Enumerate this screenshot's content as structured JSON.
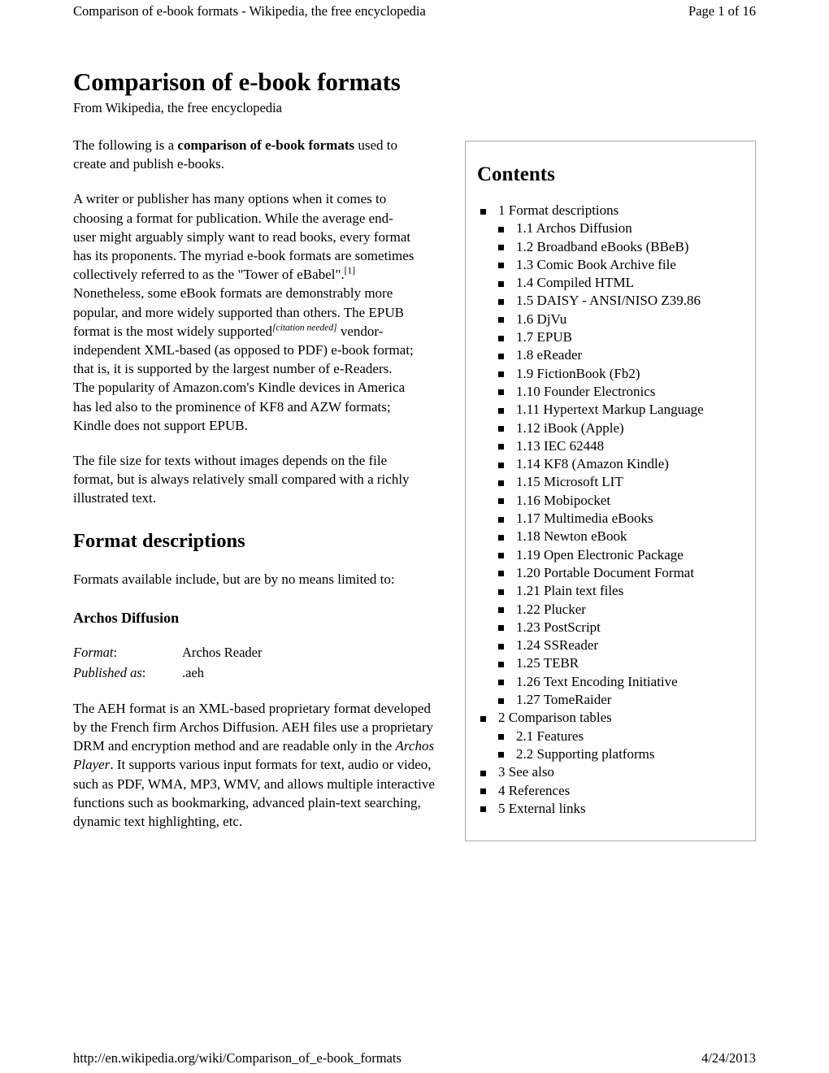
{
  "header": {
    "left": "Comparison of e-book formats - Wikipedia, the free encyclopedia",
    "right": "Page 1 of 16"
  },
  "footer": {
    "url": "http://en.wikipedia.org/wiki/Comparison_of_e-book_formats",
    "date": "4/24/2013"
  },
  "article": {
    "title": "Comparison of e-book formats",
    "tagline": "From Wikipedia, the free encyclopedia",
    "intro_1_pre": "The following is a ",
    "intro_1_bold": "comparison of e-book formats",
    "intro_1_post": " used to create and publish e-books.",
    "intro_2_a": "A writer or publisher has many options when it comes to choosing a format for publication. While the average end-user might arguably simply want to read books, every format has its proponents. The myriad e-book formats are sometimes collectively referred to as the \"Tower of eBabel\".",
    "intro_2_cite1": "[1]",
    "intro_2_b": " Nonetheless, some eBook formats are demonstrably more popular, and more widely supported than others. The EPUB format is the most widely supported",
    "intro_2_cite2": "[citation needed]",
    "intro_2_c": " vendor-independent XML-based (as opposed to PDF) e-book format; that is, it is supported by the largest number of e-Readers. The popularity of Amazon.com's Kindle devices in America has led also to the prominence of KF8 and AZW formats; Kindle does not support EPUB.",
    "intro_3": "The file size for texts without images depends on the file format, but is always relatively small compared with a richly illustrated text.",
    "section_format_descriptions": "Format descriptions",
    "formats_available": "Formats available include, but are by no means limited to:",
    "archos_heading": "Archos Diffusion",
    "archos_def": [
      {
        "term": "Format",
        "colon": ":",
        "value": "Archos Reader"
      },
      {
        "term": "Published as",
        "colon": ":",
        "value": ".aeh"
      }
    ],
    "aeh_para_a": "The AEH format is an XML-based proprietary format developed by the French firm Archos Diffusion. AEH files use a proprietary DRM and encryption method and are readable only in the ",
    "aeh_para_italic": "Archos Player",
    "aeh_para_b": ". It supports various input formats for text, audio or video, such as PDF, WMA, MP3, WMV, and allows multiple interactive functions such as bookmarking, advanced plain-text searching, dynamic text highlighting, etc."
  },
  "toc": {
    "title": "Contents",
    "items": [
      {
        "level": 1,
        "label": "1 Format descriptions"
      },
      {
        "level": 2,
        "label": "1.1 Archos Diffusion"
      },
      {
        "level": 2,
        "label": "1.2 Broadband eBooks (BBeB)"
      },
      {
        "level": 2,
        "label": "1.3 Comic Book Archive file"
      },
      {
        "level": 2,
        "label": "1.4 Compiled HTML"
      },
      {
        "level": 2,
        "label": "1.5 DAISY - ANSI/NISO Z39.86"
      },
      {
        "level": 2,
        "label": "1.6 DjVu"
      },
      {
        "level": 2,
        "label": "1.7 EPUB"
      },
      {
        "level": 2,
        "label": "1.8 eReader"
      },
      {
        "level": 2,
        "label": "1.9 FictionBook (Fb2)"
      },
      {
        "level": 2,
        "label": "1.10 Founder Electronics"
      },
      {
        "level": 2,
        "label": "1.11 Hypertext Markup Language"
      },
      {
        "level": 2,
        "label": "1.12 iBook (Apple)"
      },
      {
        "level": 2,
        "label": "1.13 IEC 62448"
      },
      {
        "level": 2,
        "label": "1.14 KF8 (Amazon Kindle)"
      },
      {
        "level": 2,
        "label": "1.15 Microsoft LIT"
      },
      {
        "level": 2,
        "label": "1.16 Mobipocket"
      },
      {
        "level": 2,
        "label": "1.17 Multimedia eBooks"
      },
      {
        "level": 2,
        "label": "1.18 Newton eBook"
      },
      {
        "level": 2,
        "label": "1.19 Open Electronic Package"
      },
      {
        "level": 2,
        "label": "1.20 Portable Document Format"
      },
      {
        "level": 2,
        "label": "1.21 Plain text files"
      },
      {
        "level": 2,
        "label": "1.22 Plucker"
      },
      {
        "level": 2,
        "label": "1.23 PostScript"
      },
      {
        "level": 2,
        "label": "1.24 SSReader"
      },
      {
        "level": 2,
        "label": "1.25 TEBR"
      },
      {
        "level": 2,
        "label": "1.26 Text Encoding Initiative"
      },
      {
        "level": 2,
        "label": "1.27 TomeRaider"
      },
      {
        "level": 1,
        "label": "2 Comparison tables"
      },
      {
        "level": 2,
        "label": "2.1 Features"
      },
      {
        "level": 2,
        "label": "2.2 Supporting platforms"
      },
      {
        "level": 1,
        "label": "3 See also"
      },
      {
        "level": 1,
        "label": "4 References"
      },
      {
        "level": 1,
        "label": "5 External links"
      }
    ]
  },
  "colors": {
    "text": "#000000",
    "box_border": "#aaaaaa",
    "page_background": "#ffffff"
  }
}
